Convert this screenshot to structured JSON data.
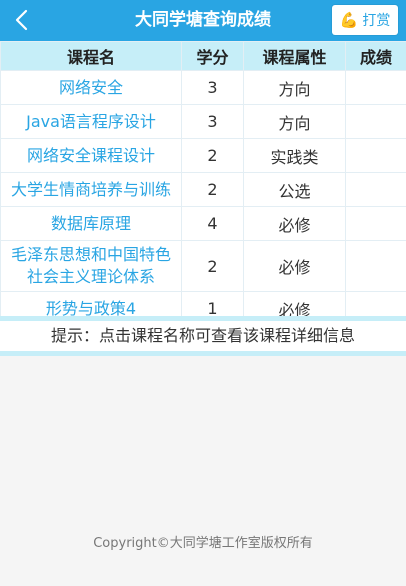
{
  "header": {
    "title": "大同学塘查询成绩",
    "reward_label": "打赏",
    "reward_icon": "strong-arm-icon",
    "back_icon": "chevron-left-icon",
    "bar_color": "#29a5e3"
  },
  "table": {
    "columns": [
      "课程名",
      "学分",
      "课程属性",
      "成绩"
    ],
    "rows": [
      {
        "course": "网络安全",
        "credit": "3",
        "attribute": "方向",
        "grade": ""
      },
      {
        "course": "Java语言程序设计",
        "credit": "3",
        "attribute": "方向",
        "grade": ""
      },
      {
        "course": "网络安全课程设计",
        "credit": "2",
        "attribute": "实践类",
        "grade": ""
      },
      {
        "course": "大学生情商培养与训练",
        "credit": "2",
        "attribute": "公选",
        "grade": ""
      },
      {
        "course": "数据库原理",
        "credit": "4",
        "attribute": "必修",
        "grade": ""
      },
      {
        "course": "毛泽东思想和中国特色社会主义理论体系",
        "credit": "2",
        "attribute": "必修",
        "grade": ""
      },
      {
        "course": "形势与政策4",
        "credit": "1",
        "attribute": "必修",
        "grade": ""
      }
    ]
  },
  "hint": "提示：点击课程名称可查看该课程详细信息",
  "footer": "Copyright©大同学塘工作室版权所有"
}
